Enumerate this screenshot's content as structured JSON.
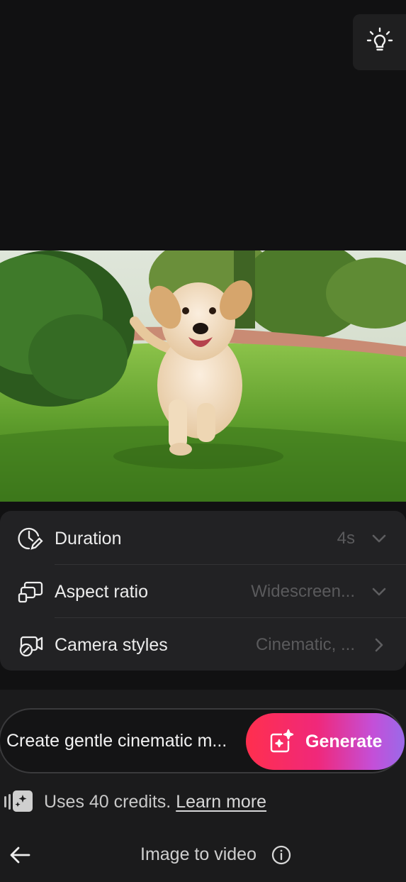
{
  "tips": {
    "icon": "lightbulb-icon"
  },
  "photo": {
    "subject": "golden retriever puppy running on grass",
    "icon": "image"
  },
  "settings": {
    "items": [
      {
        "label": "Duration",
        "value": "4s",
        "icon": "clock-pen-icon",
        "chevron": "chevron-down-icon"
      },
      {
        "label": "Aspect ratio",
        "value": "Widescreen...",
        "icon": "aspect-ratio-icon",
        "chevron": "chevron-down-icon"
      },
      {
        "label": "Camera styles",
        "value": "Cinematic, ...",
        "icon": "camera-styles-icon",
        "chevron": "chevron-right-icon"
      }
    ]
  },
  "prompt": {
    "text": "Create gentle cinematic m...",
    "generate_label": "Generate",
    "generate_icon": "sparkle-image-icon"
  },
  "credits": {
    "text": "Uses 40 credits.",
    "link": "Learn more",
    "icon": "credits-icon"
  },
  "footer": {
    "title": "Image to video",
    "back_icon": "arrow-left-icon",
    "info_icon": "info-icon"
  },
  "colors": {
    "background": "#111112",
    "panel": "#222224",
    "generate_gradient_start": "#ff2f4e",
    "generate_gradient_end": "#9a6ae9"
  }
}
